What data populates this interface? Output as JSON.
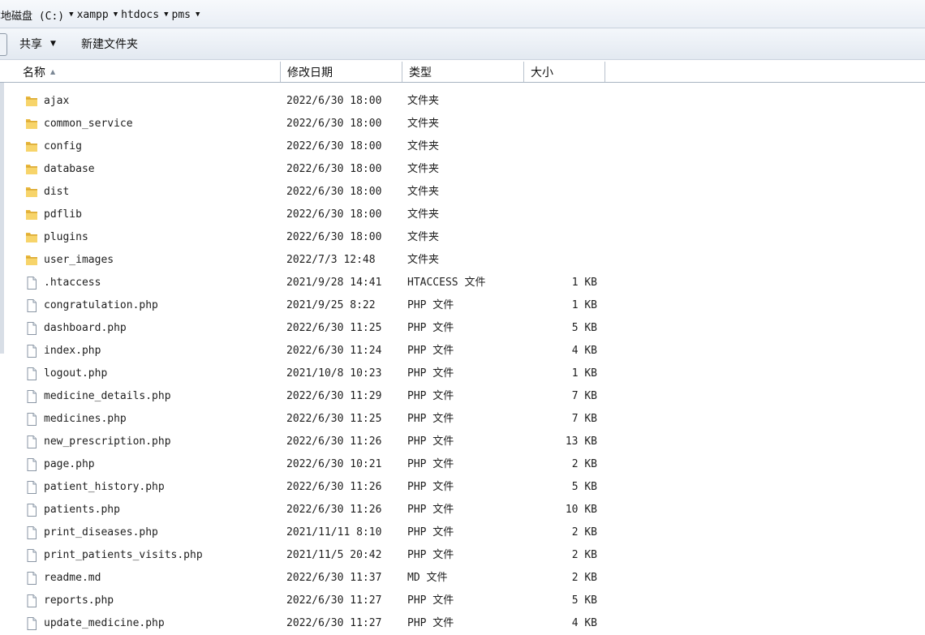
{
  "breadcrumb": [
    {
      "label": "本地磁盘 (C:)"
    },
    {
      "label": "xampp"
    },
    {
      "label": "htdocs"
    },
    {
      "label": "pms"
    }
  ],
  "toolbar": {
    "share_label": "共享",
    "new_folder_label": "新建文件夹"
  },
  "columns": {
    "name": "名称",
    "date": "修改日期",
    "type": "类型",
    "size": "大小"
  },
  "files": [
    {
      "name": "ajax",
      "date": "2022/6/30 18:00",
      "type": "文件夹",
      "size": "",
      "kind": "folder"
    },
    {
      "name": "common_service",
      "date": "2022/6/30 18:00",
      "type": "文件夹",
      "size": "",
      "kind": "folder"
    },
    {
      "name": "config",
      "date": "2022/6/30 18:00",
      "type": "文件夹",
      "size": "",
      "kind": "folder"
    },
    {
      "name": "database",
      "date": "2022/6/30 18:00",
      "type": "文件夹",
      "size": "",
      "kind": "folder"
    },
    {
      "name": "dist",
      "date": "2022/6/30 18:00",
      "type": "文件夹",
      "size": "",
      "kind": "folder"
    },
    {
      "name": "pdflib",
      "date": "2022/6/30 18:00",
      "type": "文件夹",
      "size": "",
      "kind": "folder"
    },
    {
      "name": "plugins",
      "date": "2022/6/30 18:00",
      "type": "文件夹",
      "size": "",
      "kind": "folder"
    },
    {
      "name": "user_images",
      "date": "2022/7/3 12:48",
      "type": "文件夹",
      "size": "",
      "kind": "folder"
    },
    {
      "name": ".htaccess",
      "date": "2021/9/28 14:41",
      "type": "HTACCESS 文件",
      "size": "1 KB",
      "kind": "file"
    },
    {
      "name": "congratulation.php",
      "date": "2021/9/25 8:22",
      "type": "PHP 文件",
      "size": "1 KB",
      "kind": "file"
    },
    {
      "name": "dashboard.php",
      "date": "2022/6/30 11:25",
      "type": "PHP 文件",
      "size": "5 KB",
      "kind": "file"
    },
    {
      "name": "index.php",
      "date": "2022/6/30 11:24",
      "type": "PHP 文件",
      "size": "4 KB",
      "kind": "file"
    },
    {
      "name": "logout.php",
      "date": "2021/10/8 10:23",
      "type": "PHP 文件",
      "size": "1 KB",
      "kind": "file"
    },
    {
      "name": "medicine_details.php",
      "date": "2022/6/30 11:29",
      "type": "PHP 文件",
      "size": "7 KB",
      "kind": "file"
    },
    {
      "name": "medicines.php",
      "date": "2022/6/30 11:25",
      "type": "PHP 文件",
      "size": "7 KB",
      "kind": "file"
    },
    {
      "name": "new_prescription.php",
      "date": "2022/6/30 11:26",
      "type": "PHP 文件",
      "size": "13 KB",
      "kind": "file"
    },
    {
      "name": "page.php",
      "date": "2022/6/30 10:21",
      "type": "PHP 文件",
      "size": "2 KB",
      "kind": "file"
    },
    {
      "name": "patient_history.php",
      "date": "2022/6/30 11:26",
      "type": "PHP 文件",
      "size": "5 KB",
      "kind": "file"
    },
    {
      "name": "patients.php",
      "date": "2022/6/30 11:26",
      "type": "PHP 文件",
      "size": "10 KB",
      "kind": "file"
    },
    {
      "name": "print_diseases.php",
      "date": "2021/11/11 8:10",
      "type": "PHP 文件",
      "size": "2 KB",
      "kind": "file"
    },
    {
      "name": "print_patients_visits.php",
      "date": "2021/11/5 20:42",
      "type": "PHP 文件",
      "size": "2 KB",
      "kind": "file"
    },
    {
      "name": "readme.md",
      "date": "2022/6/30 11:37",
      "type": "MD 文件",
      "size": "2 KB",
      "kind": "file"
    },
    {
      "name": "reports.php",
      "date": "2022/6/30 11:27",
      "type": "PHP 文件",
      "size": "5 KB",
      "kind": "file"
    },
    {
      "name": "update_medicine.php",
      "date": "2022/6/30 11:27",
      "type": "PHP 文件",
      "size": "4 KB",
      "kind": "file"
    }
  ],
  "icons": {
    "folder": "folder-icon",
    "file": "file-icon",
    "dropdown": "chevron-down-icon",
    "sort": "sort-ascending-icon"
  }
}
